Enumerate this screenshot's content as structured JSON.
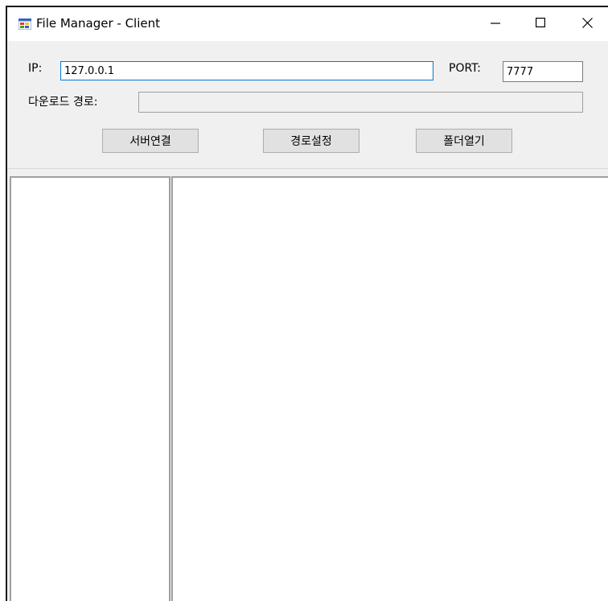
{
  "window": {
    "title": "File Manager - Client"
  },
  "form": {
    "ip_label": "IP:",
    "ip_value": "127.0.0.1",
    "port_label": "PORT:",
    "port_value": "7777",
    "download_path_label": "다운로드 경로:",
    "download_path_value": ""
  },
  "buttons": {
    "connect_label": "서버연결",
    "set_path_label": "경로설정",
    "open_folder_label": "폴더열기"
  },
  "icons": {
    "app": "app-window-icon",
    "minimize": "minimize-icon",
    "maximize": "maximize-icon",
    "close": "close-icon"
  }
}
